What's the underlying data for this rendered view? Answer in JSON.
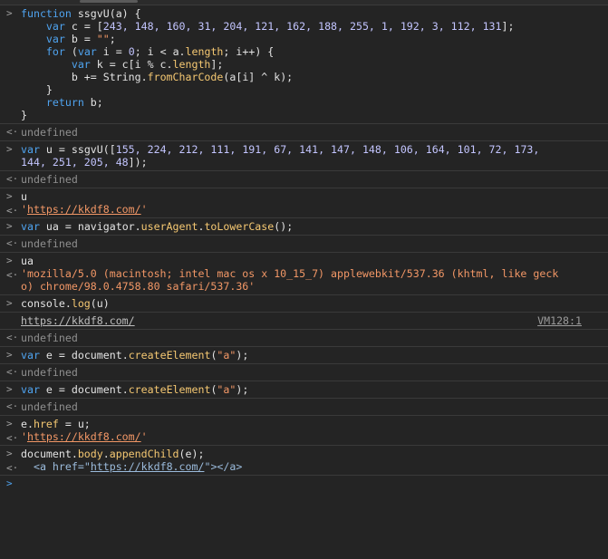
{
  "prompt_glyph": ">",
  "result_glyph": "<·",
  "console": {
    "fn": {
      "l1_kw": "function",
      "l1_rest": " ssgvU(a) {",
      "l2_pre": "    var",
      "l2_mid": " c = [",
      "l2_nums": "243, 148, 160, 31, 204, 121, 162, 188, 255, 1, 192, 3, 112, 131",
      "l2_end": "];",
      "l3_pre": "    var",
      "l3_mid": " b = ",
      "l3_str": "\"\"",
      "l3_end": ";",
      "l4_pre": "    for",
      "l4_a": " (",
      "l4_var": "var",
      "l4_b": " i = ",
      "l4_zero": "0",
      "l4_c": "; i < a.",
      "l4_len": "length",
      "l4_d": "; i++) {",
      "l5_pre": "        var",
      "l5_rest": " k = c[i % c.",
      "l5_len": "length",
      "l5_end": "];",
      "l6_a": "        b += String.",
      "l6_m": "fromCharCode",
      "l6_end": "(a[i] ^ k);",
      "l7": "    }",
      "l8_kw": "    return",
      "l8_end": " b;",
      "l9": "}"
    },
    "undefined": "undefined",
    "u_call_kw": "var",
    "u_call_a": " u = ssgvU([",
    "u_call_nums1": "155, 224, 212, 111, 191, 67, 141, 147, 148, 106, 164, 101, 72, 173,",
    "u_call_nums2": "144, 251, 205, 48",
    "u_call_end": "]);",
    "u_var": "u",
    "url_q": "'",
    "url": "https://kkdf8.com/",
    "ua_kw": "var",
    "ua_a": " ua = navigator.",
    "ua_m1": "userAgent",
    "ua_dot": ".",
    "ua_m2": "toLowerCase",
    "ua_end": "();",
    "ua_var": "ua",
    "ua_value1": "'mozilla/5.0 (macintosh; intel mac os x 10_15_7) applewebkit/537.36 (khtml, like geck",
    "ua_value2": "o) chrome/98.0.4758.80 safari/537.36'",
    "log_a": "console.",
    "log_m": "log",
    "log_end": "(u)",
    "log_source": "VM128:1",
    "ce_kw": "var",
    "ce_a": " e = document.",
    "ce_m": "createElement",
    "ce_b": "(",
    "ce_s": "\"a\"",
    "ce_end": ");",
    "href_a": "e.",
    "href_m": "href",
    "href_end": " = u;",
    "ac_a": "document.",
    "ac_m1": "body",
    "ac_dot": ".",
    "ac_m2": "appendChild",
    "ac_end": "(e);",
    "el_open": "<a ",
    "el_attr": "href",
    "el_eq": "=\"",
    "el_close_q": "\"",
    "el_end": "></a>"
  }
}
